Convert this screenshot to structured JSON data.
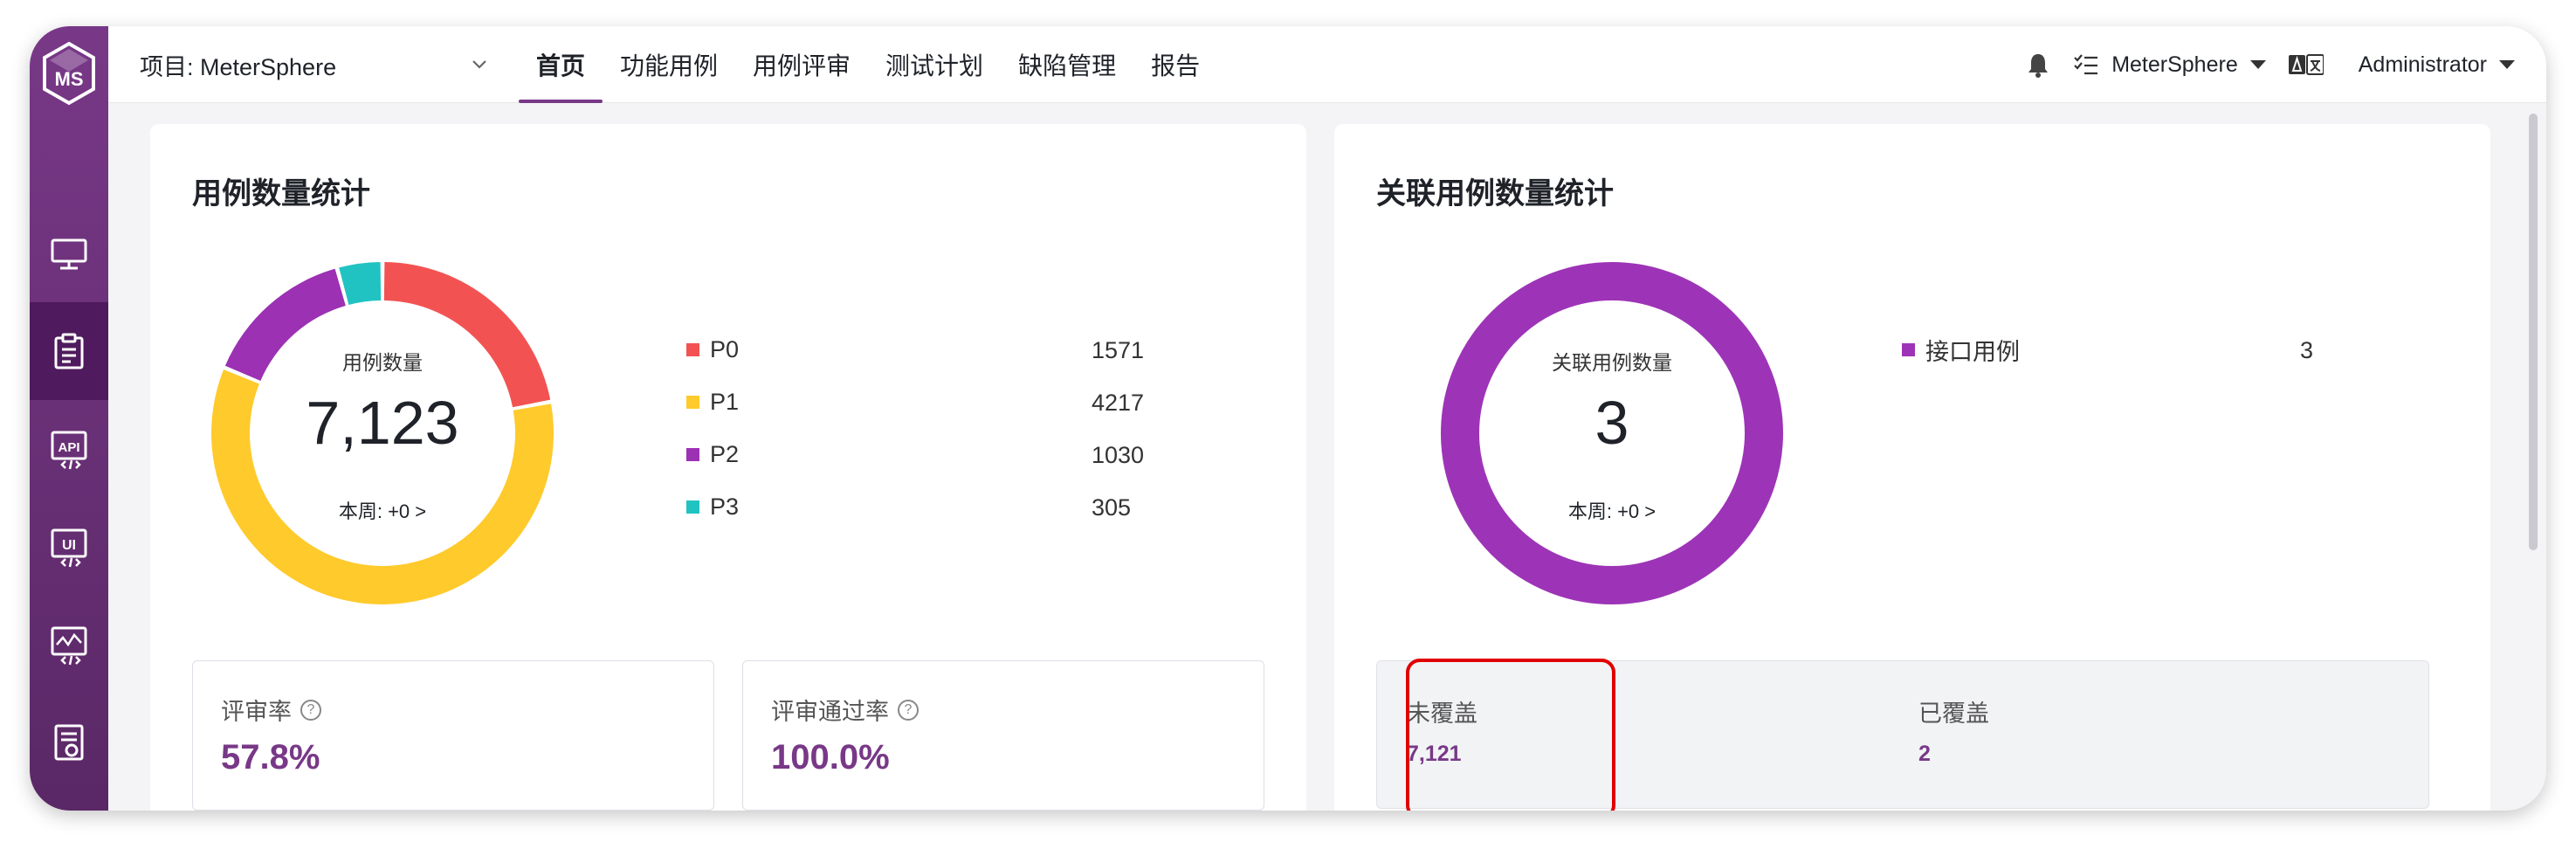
{
  "header": {
    "project_label": "项目: MeterSphere",
    "tabs": [
      {
        "label": "首页",
        "active": true
      },
      {
        "label": "功能用例"
      },
      {
        "label": "用例评审"
      },
      {
        "label": "测试计划"
      },
      {
        "label": "缺陷管理"
      },
      {
        "label": "报告"
      }
    ],
    "workspace": "MeterSphere",
    "user": "Administrator"
  },
  "sidebar": {
    "logo_text": "MS",
    "items": [
      {
        "icon": "monitor-icon"
      },
      {
        "icon": "clipboard-icon",
        "active": true
      },
      {
        "icon": "api-icon",
        "text": "API"
      },
      {
        "icon": "ui-icon",
        "text": "UI"
      },
      {
        "icon": "performance-icon"
      },
      {
        "icon": "report-icon"
      }
    ]
  },
  "case_stats": {
    "title": "用例数量统计",
    "center_label": "用例数量",
    "center_value": "7,123",
    "week": "本周: +0 >",
    "review_rate_label": "评审率",
    "review_rate": "57.8%",
    "pass_rate_label": "评审通过率",
    "pass_rate": "100.0%"
  },
  "related_stats": {
    "title": "关联用例数量统计",
    "center_label": "关联用例数量",
    "center_value": "3",
    "week": "本周: +0 >",
    "uncovered_label": "未覆盖",
    "uncovered_value": "7,121",
    "covered_label": "已覆盖",
    "covered_value": "2"
  },
  "colors": {
    "accent": "#783887",
    "p0": "#F25352",
    "p1": "#FFCA2B",
    "p2": "#9C31B3",
    "p3": "#21C3C2",
    "related": "#9D34B7",
    "highlight": "#E00000"
  },
  "chart_data": [
    {
      "type": "pie",
      "categories": [
        "P0",
        "P1",
        "P2",
        "P3"
      ],
      "values": [
        1571,
        4217,
        1030,
        305
      ]
    },
    {
      "type": "pie",
      "categories": [
        "接口用例"
      ],
      "values": [
        3
      ]
    }
  ]
}
